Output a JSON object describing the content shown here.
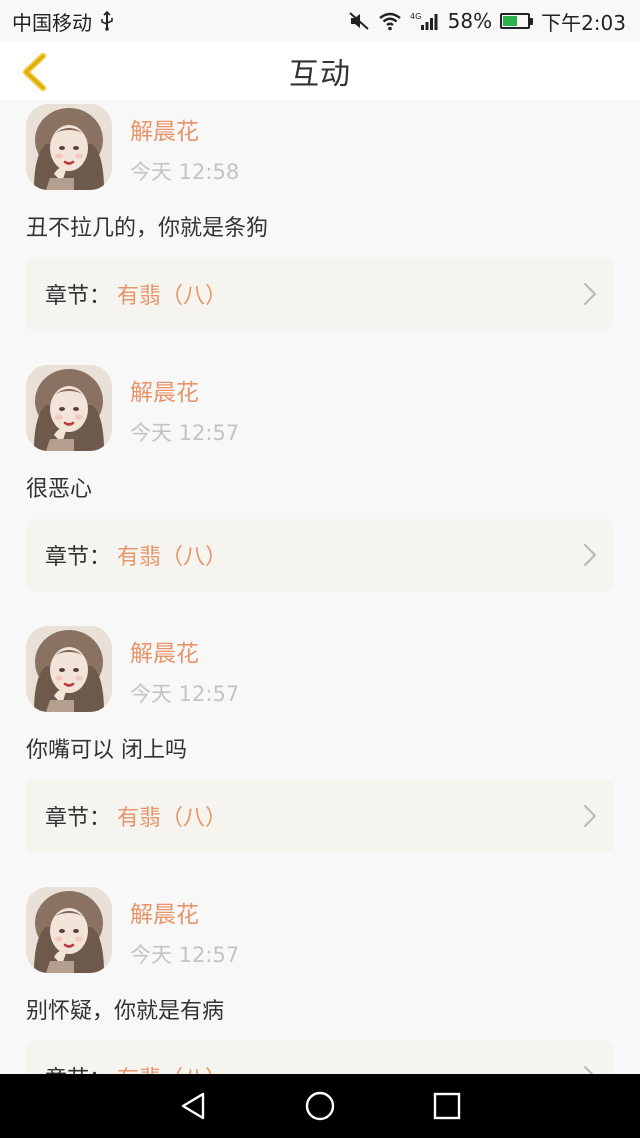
{
  "status_bar": {
    "carrier": "中国移动",
    "usb_icon": "usb-icon",
    "network_type": "4G",
    "battery": "58%",
    "battery_level": 0.58,
    "time": "下午2:03"
  },
  "header": {
    "title": "互动",
    "back_icon": "back-chevron-icon",
    "accent_color": "#f2c21b"
  },
  "comments": [
    {
      "username": "解晨花",
      "time": "今天 12:58",
      "text": "丑不拉几的，你就是条狗",
      "chapter_label": "章节：",
      "chapter_title": "有翡（八）"
    },
    {
      "username": "解晨花",
      "time": "今天 12:57",
      "text": "很恶心",
      "chapter_label": "章节：",
      "chapter_title": "有翡（八）"
    },
    {
      "username": "解晨花",
      "time": "今天 12:57",
      "text": "你嘴可以 闭上吗",
      "chapter_label": "章节：",
      "chapter_title": "有翡（八）"
    },
    {
      "username": "解晨花",
      "time": "今天 12:57",
      "text": "别怀疑，你就是有病",
      "chapter_label": "章节：",
      "chapter_title": "有翡（八）"
    }
  ],
  "colors": {
    "username": "#e8956b",
    "chapter_bg": "#f5f4ee",
    "timestamp": "#c4c4c4"
  },
  "nav_bar": {
    "back_icon": "nav-back-icon",
    "home_icon": "nav-home-icon",
    "recents_icon": "nav-recents-icon"
  }
}
